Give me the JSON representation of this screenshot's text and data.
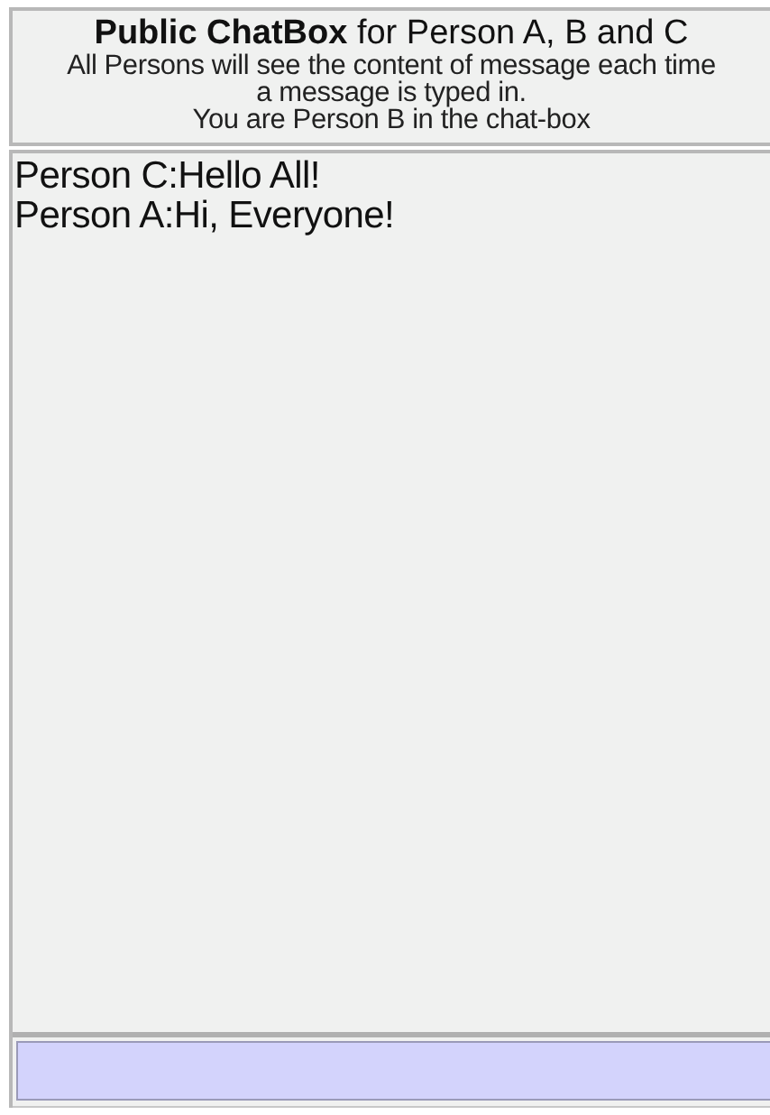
{
  "header": {
    "title": "**Public ChatBox** for Person A, B and C",
    "lines": [
      "All Persons will see the content of message each time",
      "a message is typed in.",
      "You are Person B in the chat-box"
    ]
  },
  "messages": [
    "Person C:Hello All!",
    "Person A:Hi, Everyone!"
  ]
}
